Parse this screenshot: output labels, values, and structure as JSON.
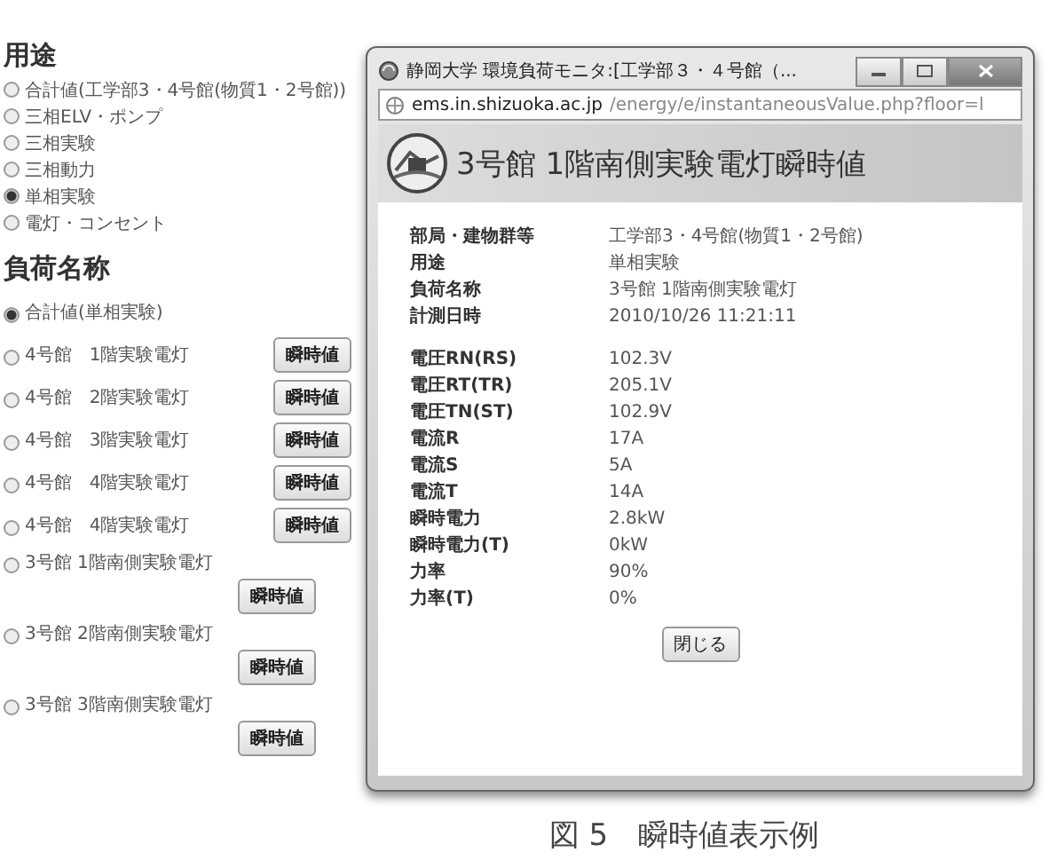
{
  "usage": {
    "heading": "用途",
    "options": [
      {
        "label": "合計値(工学部3・4号館(物質1・2号館))",
        "selected": false
      },
      {
        "label": "三相ELV・ポンプ",
        "selected": false
      },
      {
        "label": "三相実験",
        "selected": false
      },
      {
        "label": "三相動力",
        "selected": false
      },
      {
        "label": "単相実験",
        "selected": true
      },
      {
        "label": "電灯・コンセント",
        "selected": false
      }
    ]
  },
  "loads": {
    "heading": "負荷名称",
    "items": [
      {
        "kind": "plain",
        "label": "合計値(単相実験)",
        "selected": true
      },
      {
        "kind": "inline",
        "label": "4号館　1階実験電灯",
        "selected": false,
        "button": "瞬時値"
      },
      {
        "kind": "inline",
        "label": "4号館　2階実験電灯",
        "selected": false,
        "button": "瞬時値"
      },
      {
        "kind": "inline",
        "label": "4号館　3階実験電灯",
        "selected": false,
        "button": "瞬時値"
      },
      {
        "kind": "inline",
        "label": "4号館　4階実験電灯",
        "selected": false,
        "button": "瞬時値"
      },
      {
        "kind": "inline",
        "label": "4号館　4階実験電灯",
        "selected": false,
        "button": "瞬時値"
      },
      {
        "kind": "below",
        "label": "3号館 1階南側実験電灯",
        "selected": false,
        "button": "瞬時値"
      },
      {
        "kind": "below",
        "label": "3号館 2階南側実験電灯",
        "selected": false,
        "button": "瞬時値"
      },
      {
        "kind": "below",
        "label": "3号館 3階南側実験電灯",
        "selected": false,
        "button": "瞬時値"
      }
    ]
  },
  "popup": {
    "title": "静岡大学 環境負荷モニタ:[工学部３・４号館（...",
    "url_host": "ems.in.shizuoka.ac.jp",
    "url_path": "/energy/e/instantaneousValue.php?floor=l",
    "heading": "3号館 1階南側実験電灯瞬時値",
    "info": [
      {
        "label": "部局・建物群等",
        "value": "工学部3・4号館(物質1・2号館)"
      },
      {
        "label": "用途",
        "value": "単相実験"
      },
      {
        "label": "負荷名称",
        "value": "3号館 1階南側実験電灯"
      },
      {
        "label": "計測日時",
        "value": "2010/10/26 11:21:11"
      }
    ],
    "readings": [
      {
        "label": "電圧RN(RS)",
        "value": "102.3V"
      },
      {
        "label": "電圧RT(TR)",
        "value": "205.1V"
      },
      {
        "label": "電圧TN(ST)",
        "value": "102.9V"
      },
      {
        "label": "電流R",
        "value": "17A"
      },
      {
        "label": "電流S",
        "value": "5A"
      },
      {
        "label": "電流T",
        "value": "14A"
      },
      {
        "label": "瞬時電力",
        "value": "2.8kW"
      },
      {
        "label": "瞬時電力(T)",
        "value": "0kW"
      },
      {
        "label": "力率",
        "value": "90%"
      },
      {
        "label": "力率(T)",
        "value": "0%"
      }
    ],
    "close_button": "閉じる"
  },
  "caption": "図 5　瞬時値表示例"
}
